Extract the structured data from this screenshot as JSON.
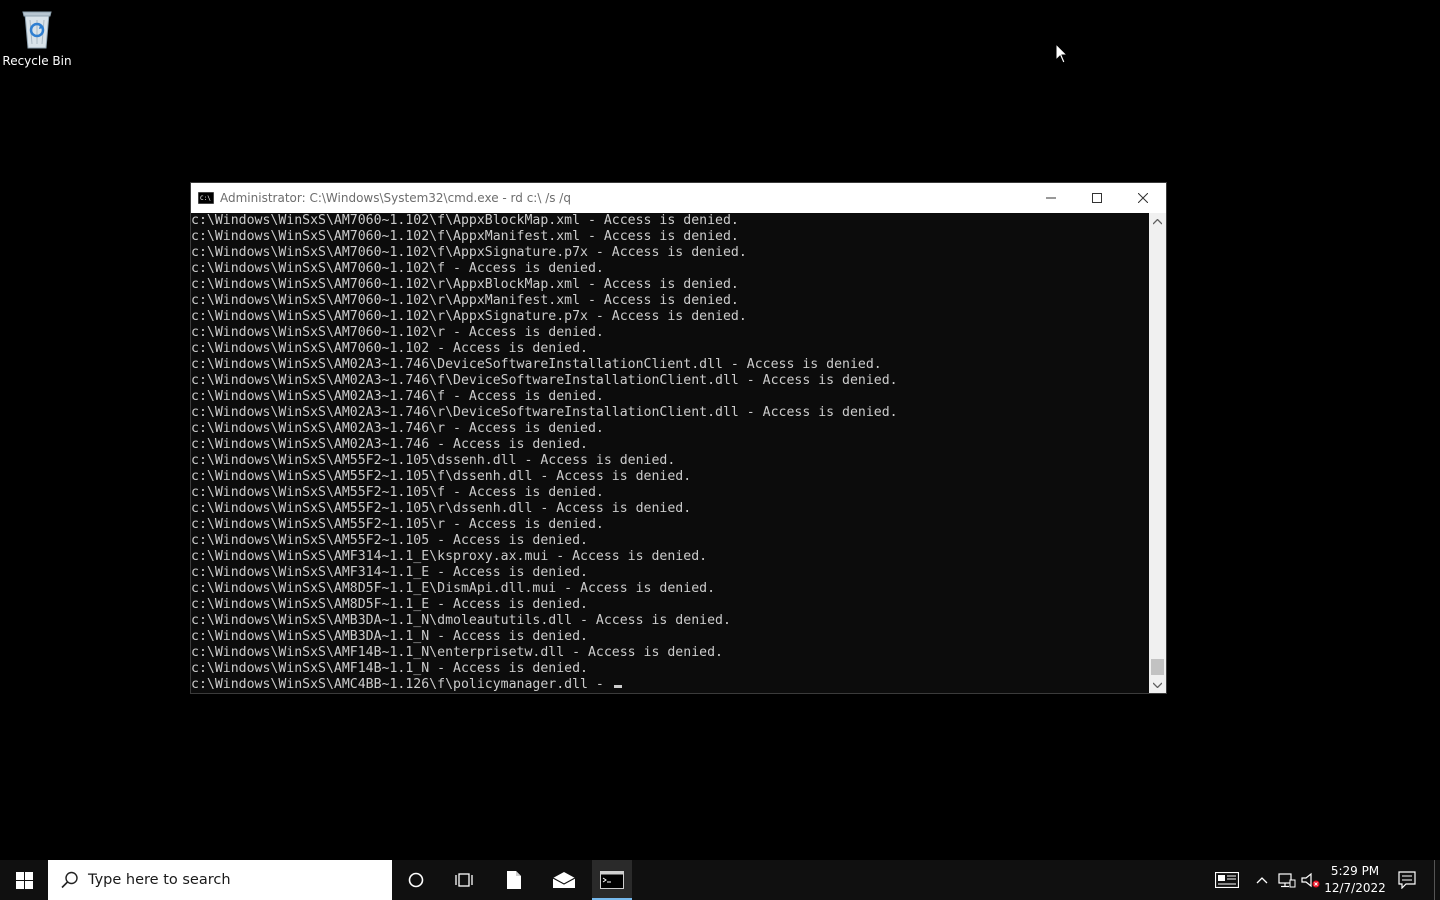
{
  "desktop": {
    "icons": [
      {
        "label": "Recycle Bin",
        "icon": "recycle-bin-icon"
      }
    ]
  },
  "console": {
    "title": "Administrator: C:\\Windows\\System32\\cmd.exe - rd  c:\\ /s /q",
    "lines": [
      "c:\\Windows\\WinSxS\\AM7060~1.102\\f\\AppxBlockMap.xml - Access is denied.",
      "c:\\Windows\\WinSxS\\AM7060~1.102\\f\\AppxManifest.xml - Access is denied.",
      "c:\\Windows\\WinSxS\\AM7060~1.102\\f\\AppxSignature.p7x - Access is denied.",
      "c:\\Windows\\WinSxS\\AM7060~1.102\\f - Access is denied.",
      "c:\\Windows\\WinSxS\\AM7060~1.102\\r\\AppxBlockMap.xml - Access is denied.",
      "c:\\Windows\\WinSxS\\AM7060~1.102\\r\\AppxManifest.xml - Access is denied.",
      "c:\\Windows\\WinSxS\\AM7060~1.102\\r\\AppxSignature.p7x - Access is denied.",
      "c:\\Windows\\WinSxS\\AM7060~1.102\\r - Access is denied.",
      "c:\\Windows\\WinSxS\\AM7060~1.102 - Access is denied.",
      "c:\\Windows\\WinSxS\\AM02A3~1.746\\DeviceSoftwareInstallationClient.dll - Access is denied.",
      "c:\\Windows\\WinSxS\\AM02A3~1.746\\f\\DeviceSoftwareInstallationClient.dll - Access is denied.",
      "c:\\Windows\\WinSxS\\AM02A3~1.746\\f - Access is denied.",
      "c:\\Windows\\WinSxS\\AM02A3~1.746\\r\\DeviceSoftwareInstallationClient.dll - Access is denied.",
      "c:\\Windows\\WinSxS\\AM02A3~1.746\\r - Access is denied.",
      "c:\\Windows\\WinSxS\\AM02A3~1.746 - Access is denied.",
      "c:\\Windows\\WinSxS\\AM55F2~1.105\\dssenh.dll - Access is denied.",
      "c:\\Windows\\WinSxS\\AM55F2~1.105\\f\\dssenh.dll - Access is denied.",
      "c:\\Windows\\WinSxS\\AM55F2~1.105\\f - Access is denied.",
      "c:\\Windows\\WinSxS\\AM55F2~1.105\\r\\dssenh.dll - Access is denied.",
      "c:\\Windows\\WinSxS\\AM55F2~1.105\\r - Access is denied.",
      "c:\\Windows\\WinSxS\\AM55F2~1.105 - Access is denied.",
      "c:\\Windows\\WinSxS\\AMF314~1.1_E\\ksproxy.ax.mui - Access is denied.",
      "c:\\Windows\\WinSxS\\AMF314~1.1_E - Access is denied.",
      "c:\\Windows\\WinSxS\\AM8D5F~1.1_E\\DismApi.dll.mui - Access is denied.",
      "c:\\Windows\\WinSxS\\AM8D5F~1.1_E - Access is denied.",
      "c:\\Windows\\WinSxS\\AMB3DA~1.1_N\\dmoleaututils.dll - Access is denied.",
      "c:\\Windows\\WinSxS\\AMB3DA~1.1_N - Access is denied.",
      "c:\\Windows\\WinSxS\\AMF14B~1.1_N\\enterprisetw.dll - Access is denied.",
      "c:\\Windows\\WinSxS\\AMF14B~1.1_N - Access is denied."
    ],
    "current_line": "c:\\Windows\\WinSxS\\AMC4BB~1.126\\f\\policymanager.dll - "
  },
  "taskbar": {
    "search_placeholder": "Type here to search",
    "pinned": [
      "cortana-icon",
      "task-view-icon",
      "file-icon",
      "mail-icon",
      "cmd-icon"
    ],
    "clock": {
      "time": "5:29 PM",
      "date": "12/7/2022"
    },
    "accent_color": "#76b9ed"
  }
}
